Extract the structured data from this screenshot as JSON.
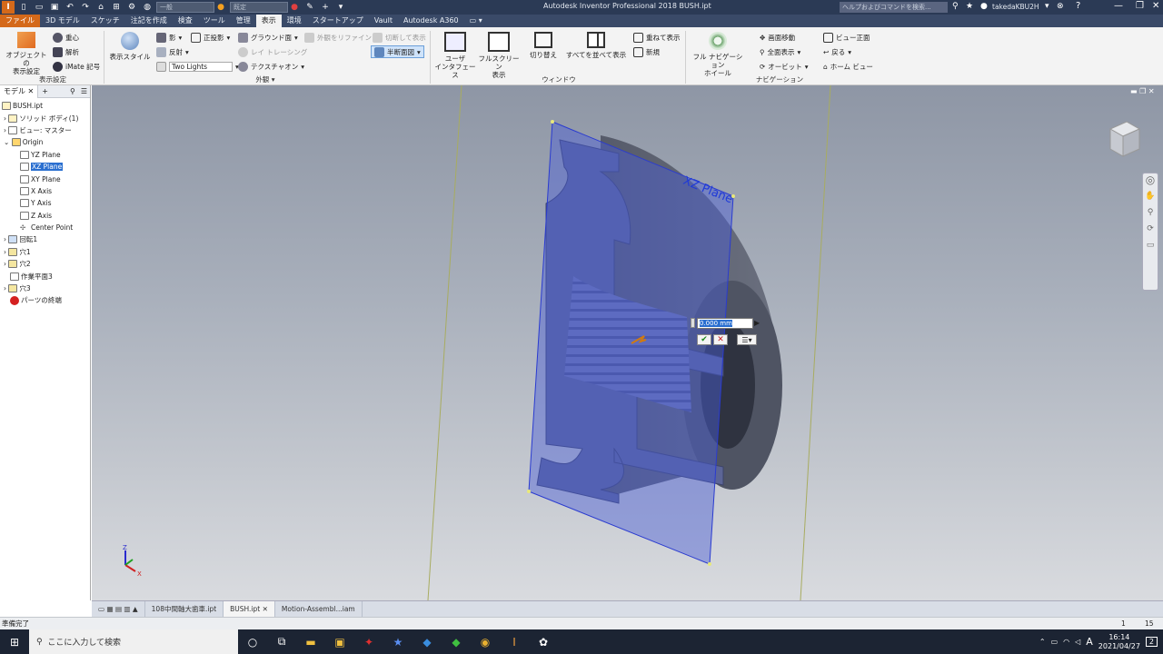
{
  "app": {
    "title": "Autodesk Inventor Professional 2018   BUSH.ipt",
    "qat_dropdown1": "一般",
    "qat_dropdown2": "既定",
    "help_search_placeholder": "ヘルプおよびコマンドを検索...",
    "user": "takedaKBU2H"
  },
  "tabs": [
    "ファイル",
    "3D モデル",
    "スケッチ",
    "注記を作成",
    "検査",
    "ツール",
    "管理",
    "表示",
    "環境",
    "スタートアップ",
    "Vault",
    "Autodesk A360"
  ],
  "active_tab": "表示",
  "ribbon": {
    "g1": {
      "obj_display": "オブジェクトの\n表示設定",
      "center": "重心",
      "analysis": "解析",
      "imate": "iMate 記号",
      "label": "表示設定"
    },
    "g2": {
      "visual_style": "表示スタイル",
      "shadow": "影",
      "projection": "正投影",
      "ground": "グラウンド面",
      "reflection": "反射",
      "ray_tracing": "レイ トレーシング",
      "lights": "Two Lights",
      "texture": "テクスチャオン",
      "exterior_refine": "外観をリファイン",
      "section_cut": "切断して表示",
      "half_section": "半断面図",
      "label": "外観"
    },
    "g3": {
      "user_interface": "ユーザ\nインタフェース",
      "fullscreen": "フルスクリーン\n表示",
      "switch": "切り替え",
      "arrange_all": "すべてを並べて表示",
      "cascade": "重ねて表示",
      "new": "新規",
      "label": "ウィンドウ"
    },
    "g4": {
      "nav_wheel": "フル ナビゲーション\nホイール",
      "pan": "画面移動",
      "zoom_all": "全面表示",
      "orbit": "オービット",
      "view_face": "ビュー正面",
      "back": "戻る",
      "home_view": "ホーム ビュー",
      "label": "ナビゲーション"
    }
  },
  "browser": {
    "tab_label": "モデル",
    "items": [
      {
        "label": "BUSH.ipt",
        "indent": 0
      },
      {
        "label": "ソリッド ボディ(1)",
        "indent": 1
      },
      {
        "label": "ビュー: マスター",
        "indent": 1
      },
      {
        "label": "Origin",
        "indent": 1
      },
      {
        "label": "YZ Plane",
        "indent": 2
      },
      {
        "label": "XZ Plane",
        "indent": 2,
        "selected": true
      },
      {
        "label": "XY Plane",
        "indent": 2
      },
      {
        "label": "X Axis",
        "indent": 2
      },
      {
        "label": "Y Axis",
        "indent": 2
      },
      {
        "label": "Z Axis",
        "indent": 2
      },
      {
        "label": "Center Point",
        "indent": 2
      },
      {
        "label": "回転1",
        "indent": 1
      },
      {
        "label": "穴1",
        "indent": 1
      },
      {
        "label": "穴2",
        "indent": 1
      },
      {
        "label": "作業平面3",
        "indent": 1
      },
      {
        "label": "穴3",
        "indent": 1
      },
      {
        "label": "パーツの終端",
        "indent": 1
      }
    ]
  },
  "viewport": {
    "plane_label": "XZ Plane",
    "offset_value": "0.000 mm",
    "axis_z": "Z",
    "axis_x": "X"
  },
  "doc_tabs": [
    "108中間軸大歯車.ipt",
    "BUSH.ipt",
    "Motion-Assembl...iam"
  ],
  "active_doc": "BUSH.ipt",
  "status": {
    "text": "準備完了",
    "n1": "1",
    "n2": "15"
  },
  "taskbar": {
    "search_placeholder": "ここに入力して検索",
    "time": "16:14",
    "date": "2021/04/27",
    "ime": "A",
    "notif": "2"
  },
  "colors": {
    "accent": "#2a6fd0",
    "file_tab": "#d4691a",
    "part": "#6b74a8",
    "plane": "#4a5ed8"
  }
}
